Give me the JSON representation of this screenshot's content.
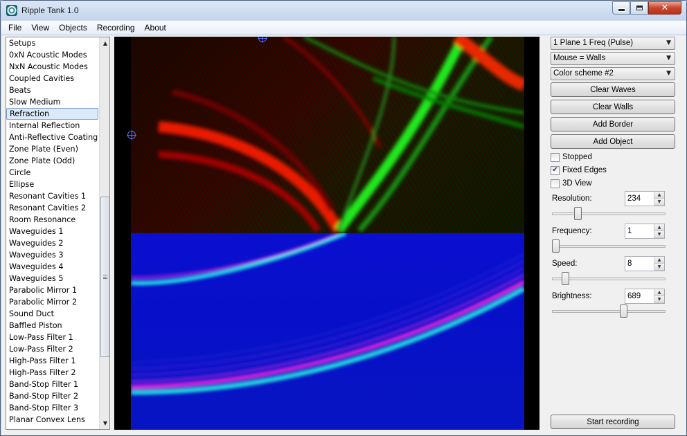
{
  "window": {
    "title": "Ripple Tank 1.0"
  },
  "menu": [
    "File",
    "View",
    "Objects",
    "Recording",
    "About"
  ],
  "setups": {
    "items": [
      "Setups",
      "0xN Acoustic Modes",
      "NxN Acoustic Modes",
      "Coupled Cavities",
      "Beats",
      "Slow Medium",
      "Refraction",
      "Internal Reflection",
      "Anti-Reflective Coating",
      "Zone Plate (Even)",
      "Zone Plate (Odd)",
      "Circle",
      "Ellipse",
      "Resonant Cavities 1",
      "Resonant Cavities 2",
      "Room Resonance",
      "Waveguides 1",
      "Waveguides 2",
      "Waveguides 3",
      "Waveguides 4",
      "Waveguides 5",
      "Parabolic Mirror 1",
      "Parabolic Mirror 2",
      "Sound Duct",
      "Baffled Piston",
      "Low-Pass Filter 1",
      "Low-Pass Filter 2",
      "High-Pass Filter 1",
      "High-Pass Filter 2",
      "Band-Stop Filter 1",
      "Band-Stop Filter 2",
      "Band-Stop Filter 3",
      "Planar Convex Lens"
    ],
    "selected": "Refraction"
  },
  "controls": {
    "source_mode": "1 Plane 1 Freq (Pulse)",
    "mouse_mode": "Mouse = Walls",
    "color_scheme": "Color scheme #2",
    "clear_waves": "Clear Waves",
    "clear_walls": "Clear Walls",
    "add_border": "Add Border",
    "add_object": "Add Object",
    "stopped": {
      "label": "Stopped",
      "checked": false
    },
    "fixed_edges": {
      "label": "Fixed Edges",
      "checked": true
    },
    "view_3d": {
      "label": "3D View",
      "checked": false
    },
    "resolution": {
      "label": "Resolution:",
      "value": "234",
      "level": 0.21
    },
    "frequency": {
      "label": "Frequency:",
      "value": "1",
      "level": 0.0
    },
    "speed": {
      "label": "Speed:",
      "value": "8",
      "level": 0.09
    },
    "brightness": {
      "label": "Brightness:",
      "value": "689",
      "level": 0.64
    },
    "start_recording": "Start recording"
  }
}
